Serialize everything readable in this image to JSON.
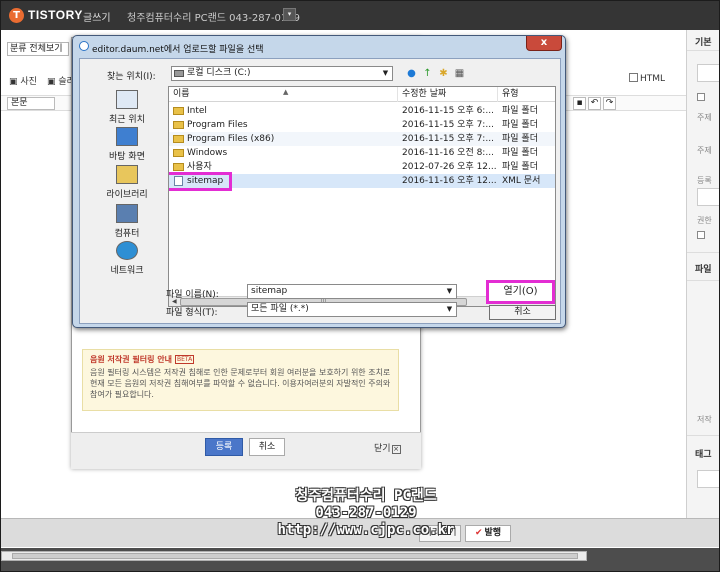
{
  "app": {
    "brand": "TISTORY",
    "mode": "글쓰기",
    "blog_title": "청주컴퓨터수리 PC랜드 043-287-0129"
  },
  "editor": {
    "category": "분류 전체보기",
    "toolbar": [
      "사진",
      "슬라"
    ],
    "html_toggle": "HTML",
    "format_select": "본문"
  },
  "right_panel": {
    "labels": [
      "기본",
      "파일",
      "태그"
    ],
    "hints": [
      "주제",
      "주제",
      "등록",
      "권한",
      "저작"
    ]
  },
  "bottom_bar": {
    "preview": "미리보기",
    "publish": "발행"
  },
  "upload_layer": {
    "notice_title": "음원 저작권 필터링 안내",
    "notice_badge": "BETA",
    "notice_body": "음원 필터링 시스템은 저작권 침해로 인한 문제로부터 회원 여러분을 보호하기 위한 조치로 현재 모든 음원의 저작권 침해여부를 파악할 수 없습니다. 이용자여러분의 자발적인 주의와 참여가 필요합니다.",
    "register": "등록",
    "cancel": "취소",
    "close": "닫기"
  },
  "dialog": {
    "title": "editor.daum.net에서 업로드할 파일을 선택",
    "close_glyph": "x",
    "look_in_label": "찾는 위치(I):",
    "look_in_value": "로컬 디스크 (C:)",
    "places": [
      "최근 위치",
      "바탕 화면",
      "라이브러리",
      "컴퓨터",
      "네트워크"
    ],
    "columns": [
      "이름",
      "수정한 날짜",
      "유형"
    ],
    "files": [
      {
        "name": "Intel",
        "date": "2016-11-15 오후 6:...",
        "type": "파일 폴더"
      },
      {
        "name": "Program Files",
        "date": "2016-11-15 오후 7:...",
        "type": "파일 폴더"
      },
      {
        "name": "Program Files (x86)",
        "date": "2016-11-15 오후 7:...",
        "type": "파일 폴더"
      },
      {
        "name": "Windows",
        "date": "2016-11-16 오전 8:...",
        "type": "파일 폴더"
      },
      {
        "name": "사용자",
        "date": "2012-07-26 오후 12...",
        "type": "파일 폴더"
      },
      {
        "name": "sitemap",
        "date": "2016-11-16 오후 12...",
        "type": "XML 문서"
      }
    ],
    "filename_label": "파일 이름(N):",
    "filename_value": "sitemap",
    "filetype_label": "파일 형식(T):",
    "filetype_value": "모든 파일 (*.*)",
    "open": "열기(O)",
    "cancel": "취소"
  },
  "watermark": {
    "line1": "청주컴퓨터수리 PC랜드",
    "line2": "043-287-0129",
    "line3": "http://www.cjpc.co.kr"
  },
  "colors": {
    "highlight": "#e32dd3",
    "topbar": "#353535",
    "brand_orange": "#ea6c31",
    "register_blue": "#4a76c9"
  }
}
